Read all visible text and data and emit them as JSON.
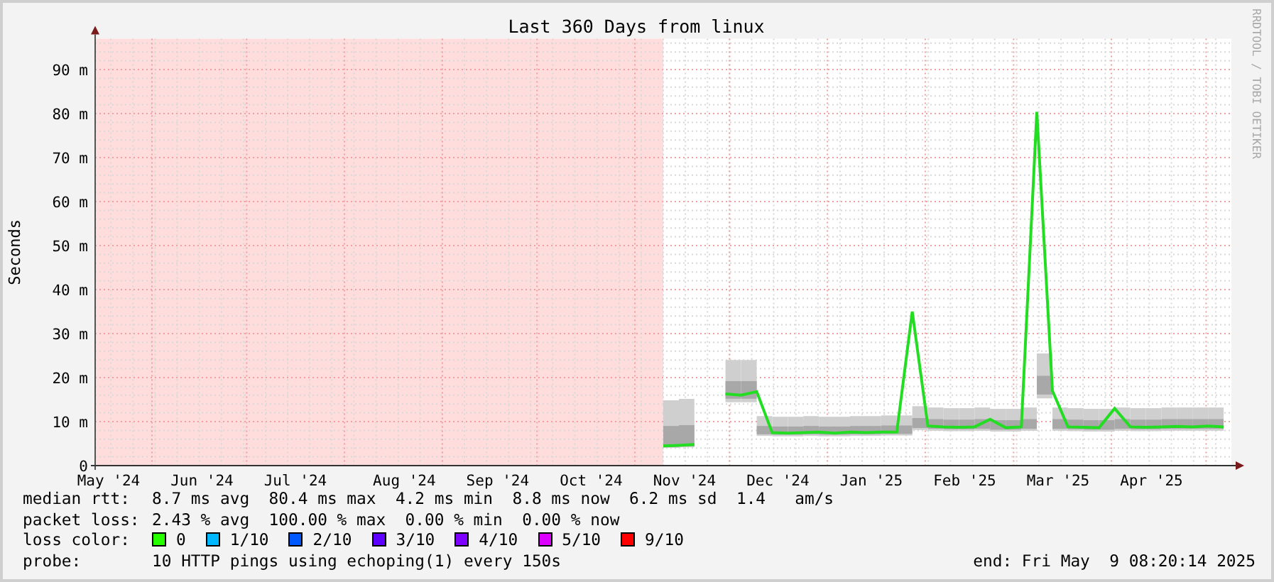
{
  "watermark_credit": "RRDTOOL / TOBI OETIKER",
  "chart_data": {
    "type": "line",
    "title": "Last 360 Days from linux",
    "ylabel": "Seconds",
    "ylim": [
      0,
      97
    ],
    "grid": true,
    "categories": [
      "May '24",
      null,
      null,
      null,
      null,
      null,
      "Jun '24",
      null,
      null,
      null,
      null,
      null,
      "Jul '24",
      null,
      null,
      null,
      null,
      null,
      null,
      "Aug '24",
      null,
      null,
      null,
      null,
      null,
      "Sep '24",
      null,
      null,
      null,
      null,
      null,
      "Oct '24",
      null,
      null,
      null,
      null,
      null,
      "Nov '24",
      null,
      null,
      null,
      null,
      null,
      "Dec '24",
      null,
      null,
      null,
      null,
      null,
      "Jan '25",
      null,
      null,
      null,
      null,
      null,
      "Feb '25",
      null,
      null,
      null,
      null,
      null,
      "Mar '25",
      null,
      null,
      null,
      null,
      null,
      "Apr '25",
      null,
      null,
      null,
      null,
      null
    ],
    "yticks": [
      {
        "value": 0,
        "label": "0"
      },
      {
        "value": 10,
        "label": "10 m"
      },
      {
        "value": 20,
        "label": "20 m"
      },
      {
        "value": 30,
        "label": "30 m"
      },
      {
        "value": 40,
        "label": "40 m"
      },
      {
        "value": 50,
        "label": "50 m"
      },
      {
        "value": 60,
        "label": "60 m"
      },
      {
        "value": 70,
        "label": "70 m"
      },
      {
        "value": 80,
        "label": "80 m"
      },
      {
        "value": 90,
        "label": "90 m"
      }
    ],
    "series": [
      {
        "color": "#22dd22",
        "values": [
          null,
          null,
          null,
          null,
          null,
          null,
          null,
          null,
          null,
          null,
          null,
          null,
          null,
          null,
          null,
          null,
          null,
          null,
          null,
          null,
          null,
          null,
          null,
          null,
          null,
          null,
          null,
          null,
          null,
          null,
          null,
          null,
          null,
          null,
          null,
          null,
          4.5,
          4.6,
          4.8,
          null,
          16.3,
          16.0,
          16.8,
          7.5,
          7.4,
          7.5,
          7.6,
          7.4,
          7.6,
          7.5,
          7.6,
          7.6,
          35.0,
          9.0,
          8.8,
          8.7,
          8.8,
          10.5,
          8.6,
          8.8,
          80.4,
          17.0,
          8.8,
          8.7,
          8.6,
          13.0,
          8.8,
          8.7,
          8.8,
          8.9,
          8.8,
          9.0,
          8.8
        ]
      }
    ]
  },
  "legend": {
    "median_rtt": {
      "label": "median rtt:",
      "text": "8.7 ms avg  80.4 ms max  4.2 ms min  8.8 ms now  6.2 ms sd  1.4   am/s"
    },
    "packet_loss": {
      "label": "packet loss:",
      "text": "2.43 % avg  100.00 % max  0.00 % min  0.00 % now"
    },
    "loss_color": {
      "label": "loss color:",
      "items": [
        {
          "label": "0",
          "color": "#26ff00"
        },
        {
          "label": "1/10",
          "color": "#00b8ff"
        },
        {
          "label": "2/10",
          "color": "#0059ff"
        },
        {
          "label": "3/10",
          "color": "#5e00ff"
        },
        {
          "label": "4/10",
          "color": "#7e00ff"
        },
        {
          "label": "5/10",
          "color": "#dd00ff"
        },
        {
          "label": "9/10",
          "color": "#ff0000"
        }
      ]
    },
    "probe": {
      "label": "probe:",
      "text": "10 HTTP pings using echoping(1) every 150s"
    },
    "end": "end: Fri May  9 08:20:14 2025"
  }
}
